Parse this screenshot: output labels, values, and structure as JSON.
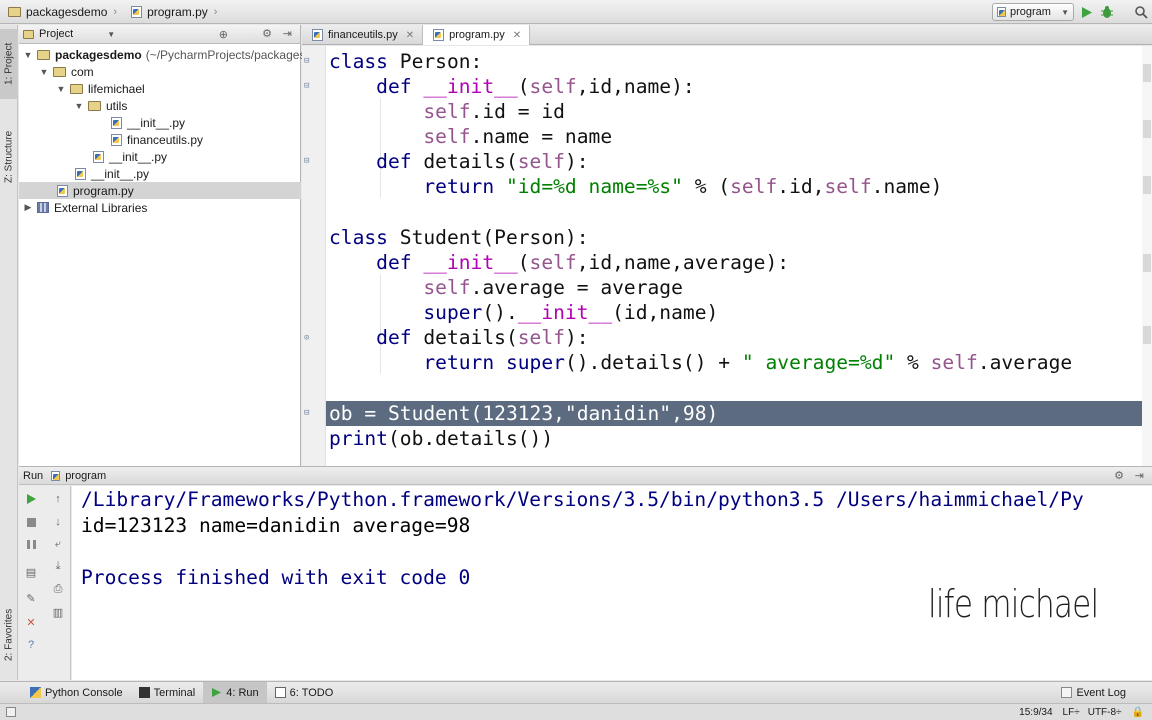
{
  "navbar": {
    "project": "packagesdemo",
    "file": "program.py",
    "run_config": "program"
  },
  "left_strip": {
    "project_tab": "1: Project",
    "structure_tab": "Z: Structure",
    "favorites_tab": "2: Favorites"
  },
  "project_panel": {
    "title": "Project",
    "tree": [
      {
        "label": "packagesdemo",
        "extra": "(~/PycharmProjects/packages"
      },
      {
        "label": "com"
      },
      {
        "label": "lifemichael"
      },
      {
        "label": "utils"
      },
      {
        "label": "__init__.py"
      },
      {
        "label": "financeutils.py"
      },
      {
        "label": "__init__.py"
      },
      {
        "label": "__init__.py"
      },
      {
        "label": "program.py"
      },
      {
        "label": "External Libraries"
      }
    ]
  },
  "editor": {
    "tabs": [
      {
        "label": "financeutils.py"
      },
      {
        "label": "program.py"
      }
    ]
  },
  "code": {
    "l1a": "class ",
    "l1b": "Person:",
    "l2a": "    def ",
    "l2b": "__init__",
    "l2c": "(",
    "l2d": "self",
    "l2e": ",id,name):",
    "l3a": "        ",
    "l3b": "self",
    "l3c": ".id = id",
    "l4a": "        ",
    "l4b": "self",
    "l4c": ".name = name",
    "l5a": "    def ",
    "l5b": "details(",
    "l5c": "self",
    "l5d": "):",
    "l6a": "        return ",
    "l6b": "\"id=%d name=%s\"",
    "l6c": " % (",
    "l6d": "self",
    "l6e": ".id,",
    "l6f": "self",
    "l6g": ".name)",
    "l8a": "class ",
    "l8b": "Student(Person):",
    "l9a": "    def ",
    "l9b": "__init__",
    "l9c": "(",
    "l9d": "self",
    "l9e": ",id,name,average):",
    "l10a": "        ",
    "l10b": "self",
    "l10c": ".average = average",
    "l11a": "        ",
    "l11b": "super",
    "l11c": "().",
    "l11d": "__init__",
    "l11e": "(id,name)",
    "l12a": "    def ",
    "l12b": "details(",
    "l12c": "self",
    "l12d": "):",
    "l13a": "        return ",
    "l13b": "super",
    "l13c": "().details() + ",
    "l13d": "\" average=%d\"",
    "l13e": " % ",
    "l13f": "self",
    "l13g": ".average",
    "l15": "ob = Student(123123,\"danidin\",98)",
    "l16a": "print",
    "l16b": "(ob.details())"
  },
  "run_panel": {
    "tab": "Run",
    "config": "program"
  },
  "console": {
    "line1": "/Library/Frameworks/Python.framework/Versions/3.5/bin/python3.5 /Users/haimmichael/Py",
    "line2": "id=123123 name=danidin average=98",
    "line3": "Process finished with exit code 0"
  },
  "watermark": "life michael",
  "bottom_bar": {
    "python_console": "Python Console",
    "terminal": "Terminal",
    "run": "4: Run",
    "todo": "6: TODO",
    "event_log": "Event Log"
  },
  "status_bar": {
    "position": "15:9/34",
    "line_sep": "LF÷",
    "encoding": "UTF-8÷"
  }
}
